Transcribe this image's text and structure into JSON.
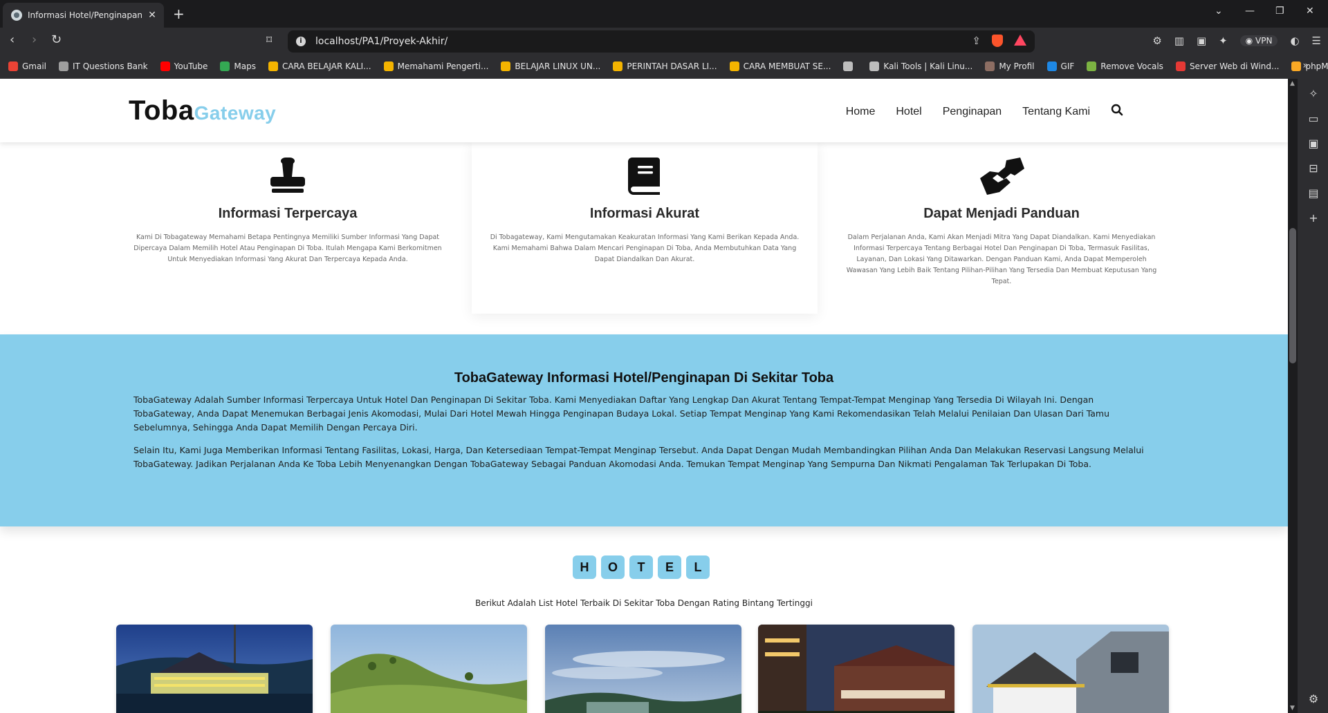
{
  "browser": {
    "tab_title": "Informasi Hotel/Penginapan/Te",
    "url": "localhost/PA1/Proyek-Akhir/",
    "vpn_label": "VPN",
    "bookmarks": [
      {
        "label": "Gmail",
        "color": "#ea4335"
      },
      {
        "label": "IT Questions Bank",
        "color": "#9e9e9e"
      },
      {
        "label": "YouTube",
        "color": "#ff0000"
      },
      {
        "label": "Maps",
        "color": "#34a853"
      },
      {
        "label": "CARA BELAJAR KALI...",
        "color": "#f4b400"
      },
      {
        "label": "Memahami Pengerti...",
        "color": "#f4b400"
      },
      {
        "label": "BELAJAR LINUX UN...",
        "color": "#f4b400"
      },
      {
        "label": "PERINTAH DASAR LI...",
        "color": "#f4b400"
      },
      {
        "label": "CARA MEMBUAT SE...",
        "color": "#f4b400"
      },
      {
        "label": "",
        "color": "#bdbdbd"
      },
      {
        "label": "Kali Tools | Kali Linu...",
        "color": "#bdbdbd"
      },
      {
        "label": "My Profil",
        "color": "#8d6e63"
      },
      {
        "label": "GIF",
        "color": "#1e88e5"
      },
      {
        "label": "Remove Vocals",
        "color": "#7cb342"
      },
      {
        "label": "Server Web di Wind...",
        "color": "#e53935"
      },
      {
        "label": "phpMyAdmin",
        "color": "#f9a825"
      }
    ]
  },
  "site": {
    "logo_main": "Toba",
    "logo_accent": "Gateway",
    "accent_color": "#87ceeb",
    "menu": [
      "Home",
      "Hotel",
      "Penginapan",
      "Tentang Kami"
    ]
  },
  "features": [
    {
      "icon": "stamp-icon",
      "title": "Informasi Terpercaya",
      "desc": "Kami Di Tobagateway Memahami Betapa Pentingnya Memiliki Sumber Informasi Yang Dapat Dipercaya Dalam Memilih Hotel Atau Penginapan Di Toba. Itulah Mengapa Kami Berkomitmen Untuk Menyediakan Informasi Yang Akurat Dan Terpercaya Kepada Anda."
    },
    {
      "icon": "book-icon",
      "title": "Informasi Akurat",
      "desc": "Di Tobagateway, Kami Mengutamakan Keakuratan Informasi Yang Kami Berikan Kepada Anda. Kami Memahami Bahwa Dalam Mencari Penginapan Di Toba, Anda Membutuhkan Data Yang Dapat Diandalkan Dan Akurat."
    },
    {
      "icon": "handshake-icon",
      "title": "Dapat Menjadi Panduan",
      "desc": "Dalam Perjalanan Anda, Kami Akan Menjadi Mitra Yang Dapat Diandalkan. Kami Menyediakan Informasi Terpercaya Tentang Berbagai Hotel Dan Penginapan Di Toba, Termasuk Fasilitas, Layanan, Dan Lokasi Yang Ditawarkan. Dengan Panduan Kami, Anda Dapat Memperoleh Wawasan Yang Lebih Baik Tentang Pilihan-Pilihan Yang Tersedia Dan Membuat Keputusan Yang Tepat."
    }
  ],
  "about": {
    "title": "TobaGateway Informasi Hotel/Penginapan Di Sekitar Toba",
    "p1": "TobaGateway Adalah Sumber Informasi Terpercaya Untuk Hotel Dan Penginapan Di Sekitar Toba. Kami Menyediakan Daftar Yang Lengkap Dan Akurat Tentang Tempat-Tempat Menginap Yang Tersedia Di Wilayah Ini. Dengan TobaGateway, Anda Dapat Menemukan Berbagai Jenis Akomodasi, Mulai Dari Hotel Mewah Hingga Penginapan Budaya Lokal. Setiap Tempat Menginap Yang Kami Rekomendasikan Telah Melalui Penilaian Dan Ulasan Dari Tamu Sebelumnya, Sehingga Anda Dapat Memilih Dengan Percaya Diri.",
    "p2": "Selain Itu, Kami Juga Memberikan Informasi Tentang Fasilitas, Lokasi, Harga, Dan Ketersediaan Tempat-Tempat Menginap Tersebut. Anda Dapat Dengan Mudah Membandingkan Pilihan Anda Dan Melakukan Reservasi Langsung Melalui TobaGateway. Jadikan Perjalanan Anda Ke Toba Lebih Menyenangkan Dengan TobaGateway Sebagai Panduan Akomodasi Anda. Temukan Tempat Menginap Yang Sempurna Dan Nikmati Pengalaman Tak Terlupakan Di Toba."
  },
  "hotel_section": {
    "letters": [
      "H",
      "O",
      "T",
      "E",
      "L"
    ],
    "subtitle": "Berikut Adalah List Hotel Terbaik Di Sekitar Toba Dengan Rating Bintang Tertinggi",
    "cards": [
      "hotel-photo-1",
      "hotel-photo-2",
      "hotel-photo-3",
      "hotel-photo-4",
      "hotel-photo-5"
    ]
  }
}
